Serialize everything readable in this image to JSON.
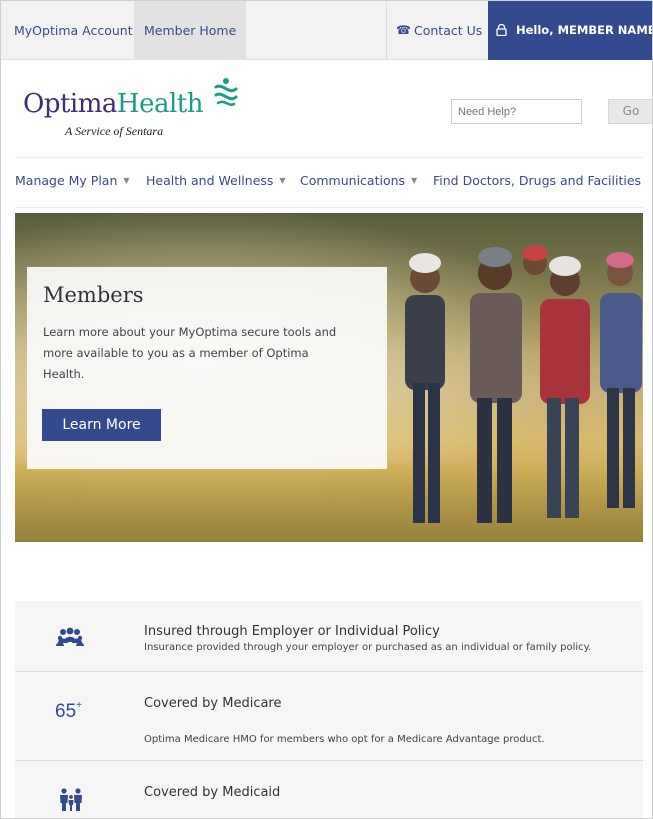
{
  "topbar": {
    "account_tab": "MyOptima Account",
    "home_tab": "Member Home",
    "contact_label": "Contact Us",
    "hello_label": "Hello, MEMBER NAME"
  },
  "logo": {
    "brand_optima": "Optima",
    "brand_health": "Health",
    "tagline": "A Service of Sentara"
  },
  "search": {
    "placeholder": "Need Help?",
    "go_label": "Go"
  },
  "nav": {
    "items": [
      {
        "label": "Manage My Plan",
        "has_dropdown": true
      },
      {
        "label": "Health and Wellness",
        "has_dropdown": true
      },
      {
        "label": "Communications",
        "has_dropdown": true
      },
      {
        "label": "Find Doctors, Drugs and Facilities",
        "has_dropdown": false
      }
    ]
  },
  "hero": {
    "title": "Members",
    "body": "Learn more about your MyOptima secure tools and more available to you as a member of Optima Health.",
    "button_label": "Learn More"
  },
  "plans": [
    {
      "icon": "group-icon",
      "title": "Insured through Employer or Individual Policy",
      "description": "Insurance provided through your employer or purchased as an individual or family policy."
    },
    {
      "icon": "65-plus-icon",
      "icon_text": "65",
      "icon_sup": "+",
      "title": "Covered by Medicare",
      "description": "Optima Medicare HMO for members who opt for a Medicare Advantage product."
    },
    {
      "icon": "family-icon",
      "title": "Covered by Medicaid",
      "description": ""
    }
  ],
  "colors": {
    "brand_blue": "#344a8f",
    "brand_purple": "#3d2c7a",
    "brand_teal": "#1f9a8a"
  }
}
